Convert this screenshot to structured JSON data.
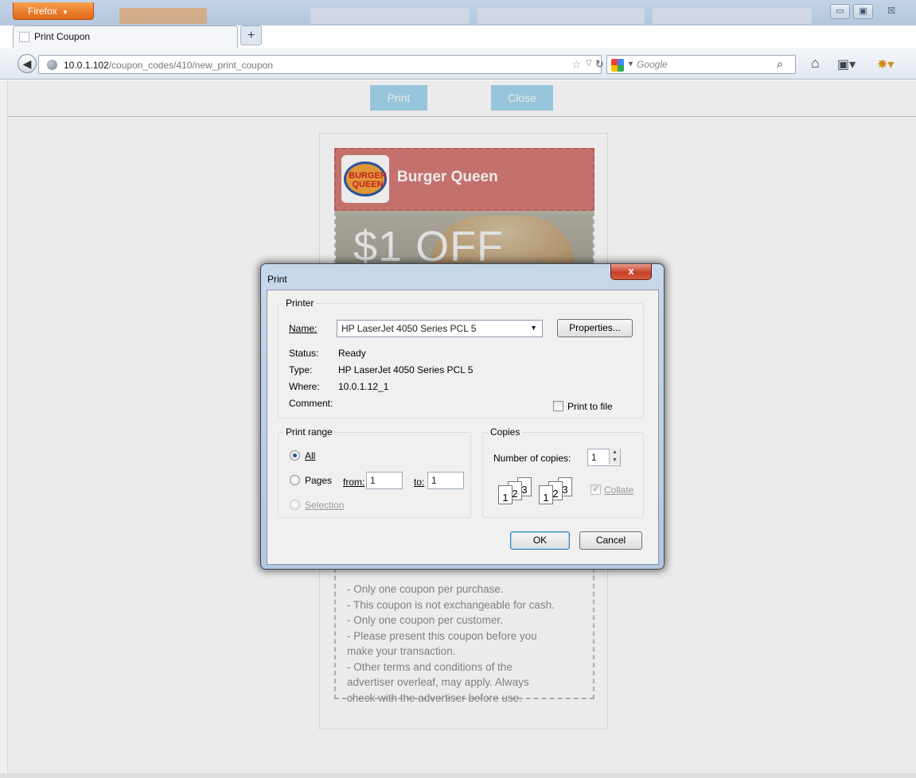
{
  "browser": {
    "menu_button": "Firefox",
    "active_tab_title": "Print Coupon",
    "new_tab_symbol": "+",
    "url_host": "10.0.1.102",
    "url_path": "/coupon_codes/410/new_print_coupon",
    "search_placeholder": "Google",
    "window_controls": {
      "minimize": "▭",
      "maximize": "▣",
      "close": "☒"
    },
    "icons": [
      "back-arrow-icon",
      "site-identity-icon",
      "bookmark-star-icon",
      "reload-icon",
      "google-search-icon",
      "magnifier-icon",
      "home-icon",
      "bookmarks-menu-icon",
      "addon-icon"
    ]
  },
  "page": {
    "print_button": "Print",
    "close_button": "Close",
    "colors": {
      "page_button": "#a4d6ee",
      "coupon_header": "#d57b78"
    },
    "coupon": {
      "logo_line1": "BURGER",
      "logo_line2": "QUEEN",
      "brand": "Burger Queen",
      "offer": "$1 OFF",
      "terms": [
        "- Only one coupon per purchase.",
        "- This coupon is not exchangeable for cash.",
        "- Only one coupon per customer.",
        "- Please present this coupon before you",
        "make your transaction.",
        "- Other terms and conditions of the",
        "advertiser overleaf, may apply. Always",
        "check with the advertiser before use."
      ]
    }
  },
  "dialog": {
    "title": "Print",
    "close_symbol": "x",
    "printer_group": "Printer",
    "name_label": "Name:",
    "printer_name": "HP LaserJet 4050 Series PCL 5",
    "properties_button": "Properties...",
    "status_label": "Status:",
    "status_value": "Ready",
    "type_label": "Type:",
    "type_value": "HP LaserJet 4050 Series PCL 5",
    "where_label": "Where:",
    "where_value": "10.0.1.12_1",
    "comment_label": "Comment:",
    "print_to_file_label": "Print to file",
    "print_to_file_checked": false,
    "range_group": "Print range",
    "range_all": "All",
    "range_pages": "Pages",
    "from_label": "from:",
    "from_value": "1",
    "to_label": "to:",
    "to_value": "1",
    "range_selection": "Selection",
    "selected_range": "All",
    "copies_group": "Copies",
    "copies_label": "Number of copies:",
    "copies_value": "1",
    "collate_label": "Collate",
    "collate_checked": true,
    "collate_page_numbers": [
      "1",
      "2",
      "3"
    ],
    "ok_button": "OK",
    "cancel_button": "Cancel"
  }
}
